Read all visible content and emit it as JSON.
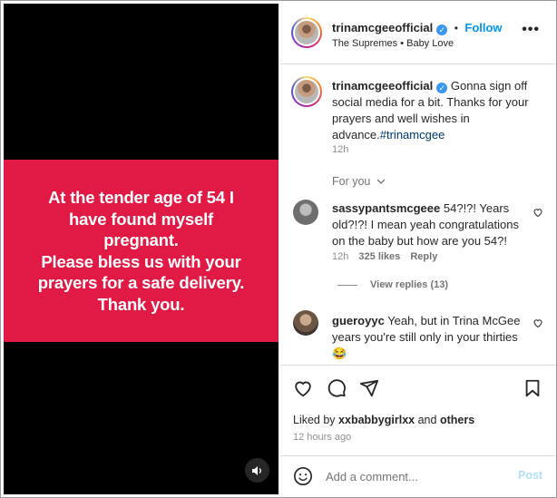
{
  "media": {
    "banner_text": "At the tender age of 54 I\nhave found myself\npregnant.\nPlease bless us with your\nprayers for a safe delivery.\nThank you.",
    "banner_color": "#e01a44",
    "sound_icon": "speaker-icon"
  },
  "header": {
    "username": "trinamcgeeofficial",
    "separator": "•",
    "follow_label": "Follow",
    "audio": "The Supremes • Baby Love",
    "more_icon": "more-options-icon"
  },
  "caption": {
    "username": "trinamcgeeofficial",
    "text": "Gonna sign off social media for a bit. Thanks for your prayers and well wishes in advance.",
    "hashtag": "#trinamcgee",
    "time": "12h"
  },
  "comments_section": {
    "filter_label": "For you"
  },
  "comments": [
    {
      "username": "sassypantsmcgeee",
      "text": "54?!?! Years old?!?! I mean yeah congratulations on the baby but how are you 54?!",
      "time": "12h",
      "likes": "325 likes",
      "reply_label": "Reply",
      "view_replies": "View replies (13)"
    },
    {
      "username": "gueroyyc",
      "text": "Yeah, but in Trina McGee years you're still only in your thirties",
      "emoji": "😂"
    }
  ],
  "actions": {
    "liked_by_prefix": "Liked by",
    "liked_by_user": "xxbabbygirlxx",
    "liked_by_and": "and",
    "liked_by_others": "others",
    "timestamp": "12 hours ago"
  },
  "composer": {
    "placeholder": "Add a comment...",
    "post_label": "Post"
  },
  "colors": {
    "accent": "#0095f6",
    "hashtag": "#00376b",
    "muted": "#8e8e8e"
  }
}
